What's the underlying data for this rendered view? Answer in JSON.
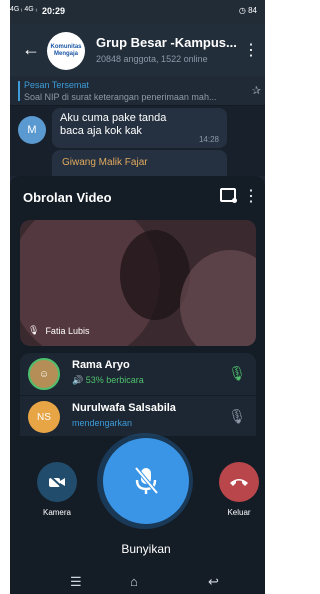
{
  "status_bar": {
    "signal": "4G ᵢ 4G ᵢ",
    "time": "20:29",
    "right": "◷ 84"
  },
  "header": {
    "back_icon": "arrow-left-icon",
    "avatar_text": "Komunitas Mengaja",
    "title": "Grup Besar -Kampus...",
    "subtitle": "20848 anggota, 1522 online"
  },
  "pinned": {
    "title": "Pesan Tersemat",
    "text": "Soal NIP di surat keterangan penerimaan mah..."
  },
  "messages": [
    {
      "avatar": "M",
      "text": "Aku cuma pake tanda baca aja kok kak",
      "time": "14:28"
    },
    {
      "sender": "Giwang Malik Fajar"
    }
  ],
  "video_chat": {
    "title": "Obrolan Video",
    "video_name": "Fatia Lubis",
    "participants": [
      {
        "name": "Rama Aryo",
        "status": "🔊 53% berbicara",
        "speaking": true
      },
      {
        "name": "Nurulwafa Salsabila",
        "status": "mendengarkan",
        "avatar": "NS",
        "speaking": false
      }
    ],
    "controls": {
      "camera_label": "Kamera",
      "unmute_label": "Bunyikan",
      "leave_label": "Keluar"
    }
  },
  "colors": {
    "accent": "#3a95e6",
    "speaking": "#4ec06c",
    "leave": "#b8464b"
  }
}
